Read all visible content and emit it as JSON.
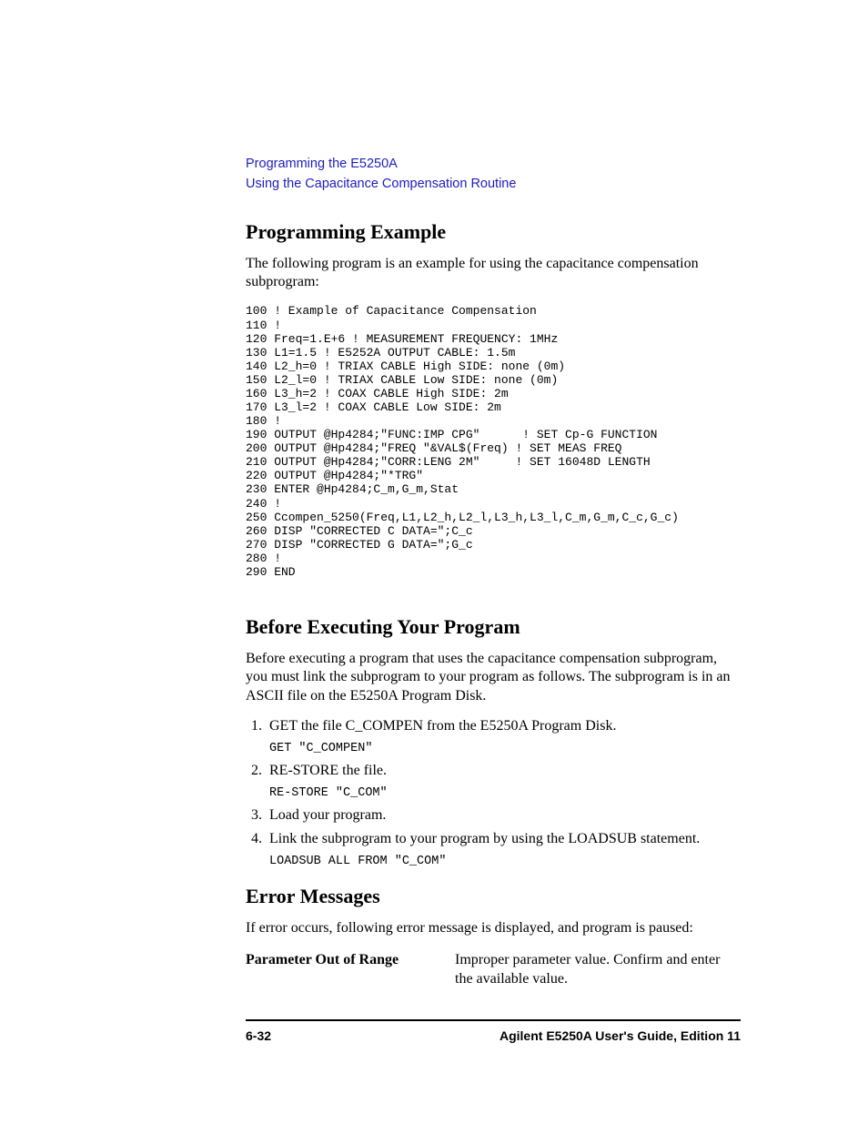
{
  "header": {
    "link1": "Programming the E5250A",
    "link2": "Using the Capacitance Compensation Routine"
  },
  "section1": {
    "heading": "Programming Example",
    "intro": "The following program is an example for using the capacitance compensation subprogram:",
    "code": "100 ! Example of Capacitance Compensation\n110 !\n120 Freq=1.E+6 ! MEASUREMENT FREQUENCY: 1MHz\n130 L1=1.5 ! E5252A OUTPUT CABLE: 1.5m\n140 L2_h=0 ! TRIAX CABLE High SIDE: none (0m)\n150 L2_l=0 ! TRIAX CABLE Low SIDE: none (0m)\n160 L3_h=2 ! COAX CABLE High SIDE: 2m\n170 L3_l=2 ! COAX CABLE Low SIDE: 2m\n180 !\n190 OUTPUT @Hp4284;\"FUNC:IMP CPG\"      ! SET Cp-G FUNCTION\n200 OUTPUT @Hp4284;\"FREQ \"&VAL$(Freq) ! SET MEAS FREQ\n210 OUTPUT @Hp4284;\"CORR:LENG 2M\"     ! SET 16048D LENGTH\n220 OUTPUT @Hp4284;\"*TRG\"\n230 ENTER @Hp4284;C_m,G_m,Stat\n240 !\n250 Ccompen_5250(Freq,L1,L2_h,L2_l,L3_h,L3_l,C_m,G_m,C_c,G_c)\n260 DISP \"CORRECTED C DATA=\";C_c\n270 DISP \"CORRECTED G DATA=\";G_c\n280 !\n290 END"
  },
  "section2": {
    "heading": "Before Executing Your Program",
    "intro": "Before executing a program that uses the capacitance compensation subprogram, you must link the subprogram to your program as follows. The subprogram is in an ASCII file on the E5250A Program Disk.",
    "steps": [
      {
        "text": "GET the file C_COMPEN from the E5250A Program Disk.",
        "code": "GET \"C_COMPEN\""
      },
      {
        "text": "RE-STORE the file.",
        "code": "RE-STORE \"C_COM\""
      },
      {
        "text": "Load your program.",
        "code": ""
      },
      {
        "text": "Link the subprogram to your program by using the LOADSUB statement.",
        "code": "LOADSUB ALL FROM \"C_COM\""
      }
    ]
  },
  "section3": {
    "heading": "Error Messages",
    "intro": "If error occurs, following error message is displayed, and program is paused:",
    "error_label": "Parameter Out of Range",
    "error_desc": "Improper parameter value. Confirm and enter the available value."
  },
  "footer": {
    "page": "6-32",
    "title": "Agilent E5250A User's Guide, Edition 11"
  }
}
